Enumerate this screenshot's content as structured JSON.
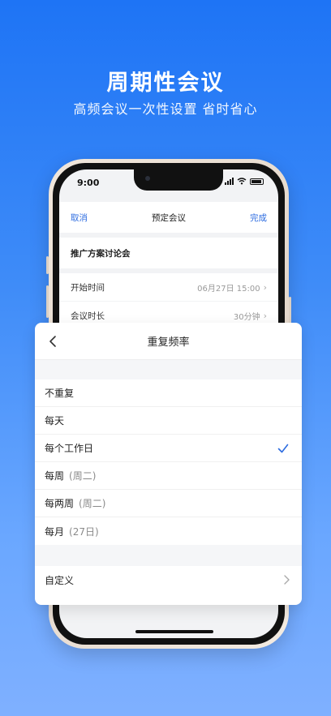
{
  "hero": {
    "title": "周期性会议",
    "subtitle": "高频会议一次性设置 省时省心"
  },
  "status_bar": {
    "time": "9:00"
  },
  "nav": {
    "cancel": "取消",
    "title": "预定会议",
    "done": "完成"
  },
  "meeting": {
    "title": "推广方案讨论会",
    "start_label": "开始时间",
    "start_value": "06月27日 15:00",
    "duration_label": "会议时长",
    "duration_value": "30分钟"
  },
  "sheet": {
    "title": "重复频率",
    "options": [
      {
        "label": "不重复",
        "hint": "",
        "selected": false
      },
      {
        "label": "每天",
        "hint": "",
        "selected": false
      },
      {
        "label": "每个工作日",
        "hint": "",
        "selected": true
      },
      {
        "label": "每周",
        "hint": "(周二)",
        "selected": false
      },
      {
        "label": "每两周",
        "hint": "(周二)",
        "selected": false
      },
      {
        "label": "每月",
        "hint": "(27日)",
        "selected": false
      }
    ],
    "custom_label": "自定义"
  },
  "colors": {
    "accent": "#2d6ce0",
    "bg_top": "#1e74f5",
    "bg_bottom": "#7fb0ff"
  }
}
